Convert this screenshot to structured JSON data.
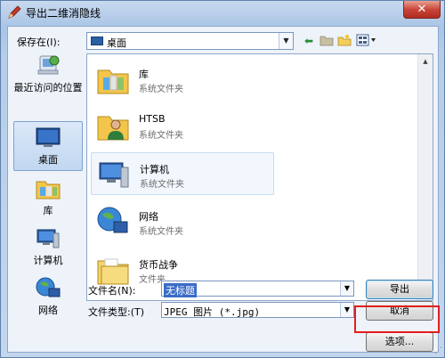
{
  "window": {
    "title": "导出二维消隐线",
    "close_label": "✕"
  },
  "lookin": {
    "label": "保存在(I):",
    "value": "桌面"
  },
  "toolbar": {
    "back_icon": "⬅",
    "up_icon": "📁",
    "new_folder_icon": "📂",
    "view_icon": "▤▾"
  },
  "places": [
    {
      "label": "最近访问的位置",
      "icon": "recent-places-icon"
    },
    {
      "label": "桌面",
      "icon": "desktop-icon"
    },
    {
      "label": "库",
      "icon": "libraries-icon"
    },
    {
      "label": "计算机",
      "icon": "computer-icon"
    },
    {
      "label": "网络",
      "icon": "network-icon"
    }
  ],
  "files": [
    {
      "name": "库",
      "type": "系统文件夹",
      "icon": "libraries-icon"
    },
    {
      "name": "HTSB",
      "type": "系统文件夹",
      "icon": "user-folder-icon"
    },
    {
      "name": "计算机",
      "type": "系统文件夹",
      "icon": "computer-icon"
    },
    {
      "name": "网络",
      "type": "系统文件夹",
      "icon": "network-icon"
    },
    {
      "name": "货币战争",
      "type": "文件夹",
      "icon": "folder-icon"
    }
  ],
  "filename": {
    "label": "文件名(N):",
    "value": "无标题"
  },
  "filetype": {
    "label": "文件类型:(T)",
    "value": "JPEG 图片 (*.jpg)"
  },
  "buttons": {
    "export": "导出",
    "cancel": "取消",
    "options": "选项..."
  },
  "colors": {
    "highlight": "#e21d1d",
    "selection": "#3a6cc7"
  }
}
